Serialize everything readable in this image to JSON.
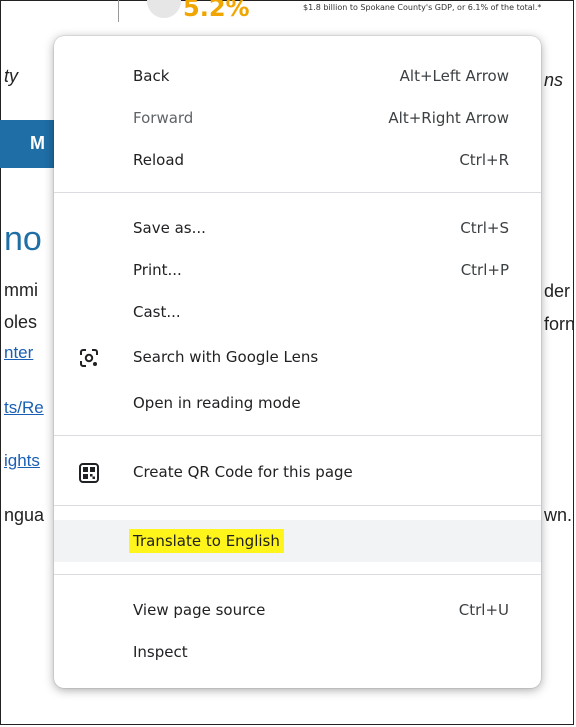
{
  "background": {
    "stat_percent": "5.2%",
    "stat_note": "$1.8 billion to Spokane County's GDP, or 6.1% of the total.*",
    "left_fragment_1": "ty",
    "right_fragment_1": "ns",
    "tab_label": "M",
    "heading_fragment": "no",
    "text_left": [
      "mmi",
      "oles",
      "nter",
      "ts/Re",
      "ights",
      "ngua"
    ],
    "text_right": [
      "der",
      "forn",
      "wn."
    ]
  },
  "menu": {
    "items": [
      {
        "label": "Back",
        "shortcut": "Alt+Left Arrow",
        "icon": null,
        "disabled": false
      },
      {
        "label": "Forward",
        "shortcut": "Alt+Right Arrow",
        "icon": null,
        "disabled": true
      },
      {
        "label": "Reload",
        "shortcut": "Ctrl+R",
        "icon": null,
        "disabled": false
      },
      {
        "label": "Save as...",
        "shortcut": "Ctrl+S",
        "icon": null,
        "disabled": false
      },
      {
        "label": "Print...",
        "shortcut": "Ctrl+P",
        "icon": null,
        "disabled": false
      },
      {
        "label": "Cast...",
        "shortcut": "",
        "icon": null,
        "disabled": false
      },
      {
        "label": "Search with Google Lens",
        "shortcut": "",
        "icon": "google-lens-icon",
        "disabled": false
      },
      {
        "label": "Open in reading mode",
        "shortcut": "",
        "icon": null,
        "disabled": false
      },
      {
        "label": "Create QR Code for this page",
        "shortcut": "",
        "icon": "qr-code-icon",
        "disabled": false
      },
      {
        "label": "Translate to English",
        "shortcut": "",
        "icon": null,
        "disabled": false,
        "highlighted": true,
        "highlight_color": "#fff51a"
      },
      {
        "label": "View page source",
        "shortcut": "Ctrl+U",
        "icon": null,
        "disabled": false
      },
      {
        "label": "Inspect",
        "shortcut": "",
        "icon": null,
        "disabled": false
      }
    ]
  }
}
